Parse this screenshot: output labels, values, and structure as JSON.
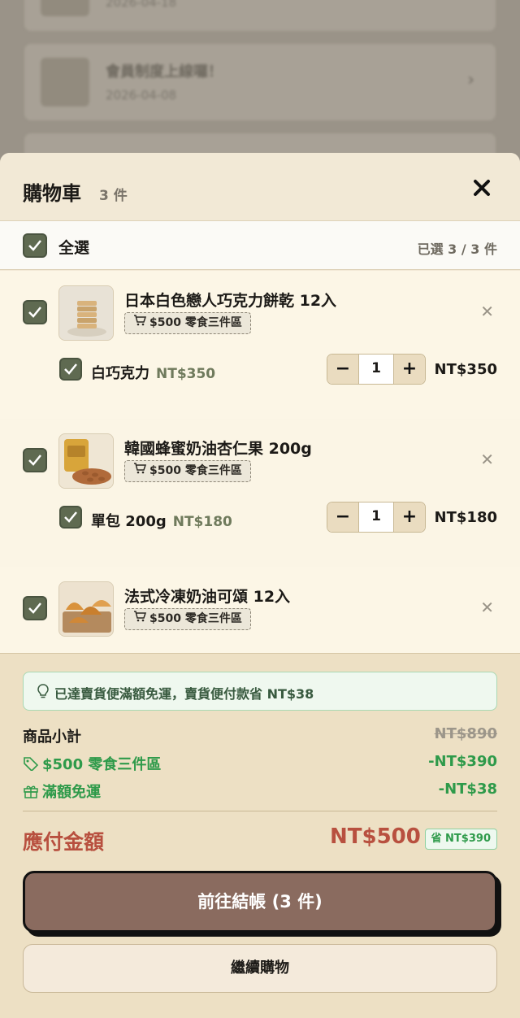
{
  "background": {
    "card_date": "2026-04-18",
    "card2_title": "會員制度上線囉！",
    "card2_date": "2026-04-08"
  },
  "cart": {
    "title": "購物車",
    "count": "3 件",
    "select_all_label": "全選",
    "selected_count": "已選 3 / 3 件"
  },
  "items": [
    {
      "name": "日本白色戀人巧克力餅乾 12入",
      "promo": "$500 零食三件區",
      "variant_name": "白巧克力",
      "variant_price": "NT$350",
      "qty": "1",
      "line_total": "NT$350"
    },
    {
      "name": "韓國蜂蜜奶油杏仁果 200g",
      "promo": "$500 零食三件區",
      "variant_name": "單包 200g",
      "variant_price": "NT$180",
      "qty": "1",
      "line_total": "NT$180"
    },
    {
      "name": "法式冷凍奶油可頌 12入",
      "promo": "$500 零食三件區"
    }
  ],
  "summary": {
    "notice": "已達賣貨便滿額免運，賣貨便付款省 NT$38",
    "subtotal_label": "商品小計",
    "subtotal_value": "NT$890",
    "promo_label": "$500 零食三件區",
    "promo_value": "-NT$390",
    "shipping_label": "滿額免運",
    "shipping_value": "-NT$38",
    "total_label": "應付金額",
    "total_value": "NT$500",
    "save_badge": "省 NT$390",
    "checkout_label": "前往結帳 (3 件)",
    "continue_label": "繼續購物"
  },
  "colors": {
    "accent": "#8a6b5f",
    "checkbox": "#5f6a51",
    "discount_green": "#2e9a4a",
    "total_red": "#b8503f"
  }
}
